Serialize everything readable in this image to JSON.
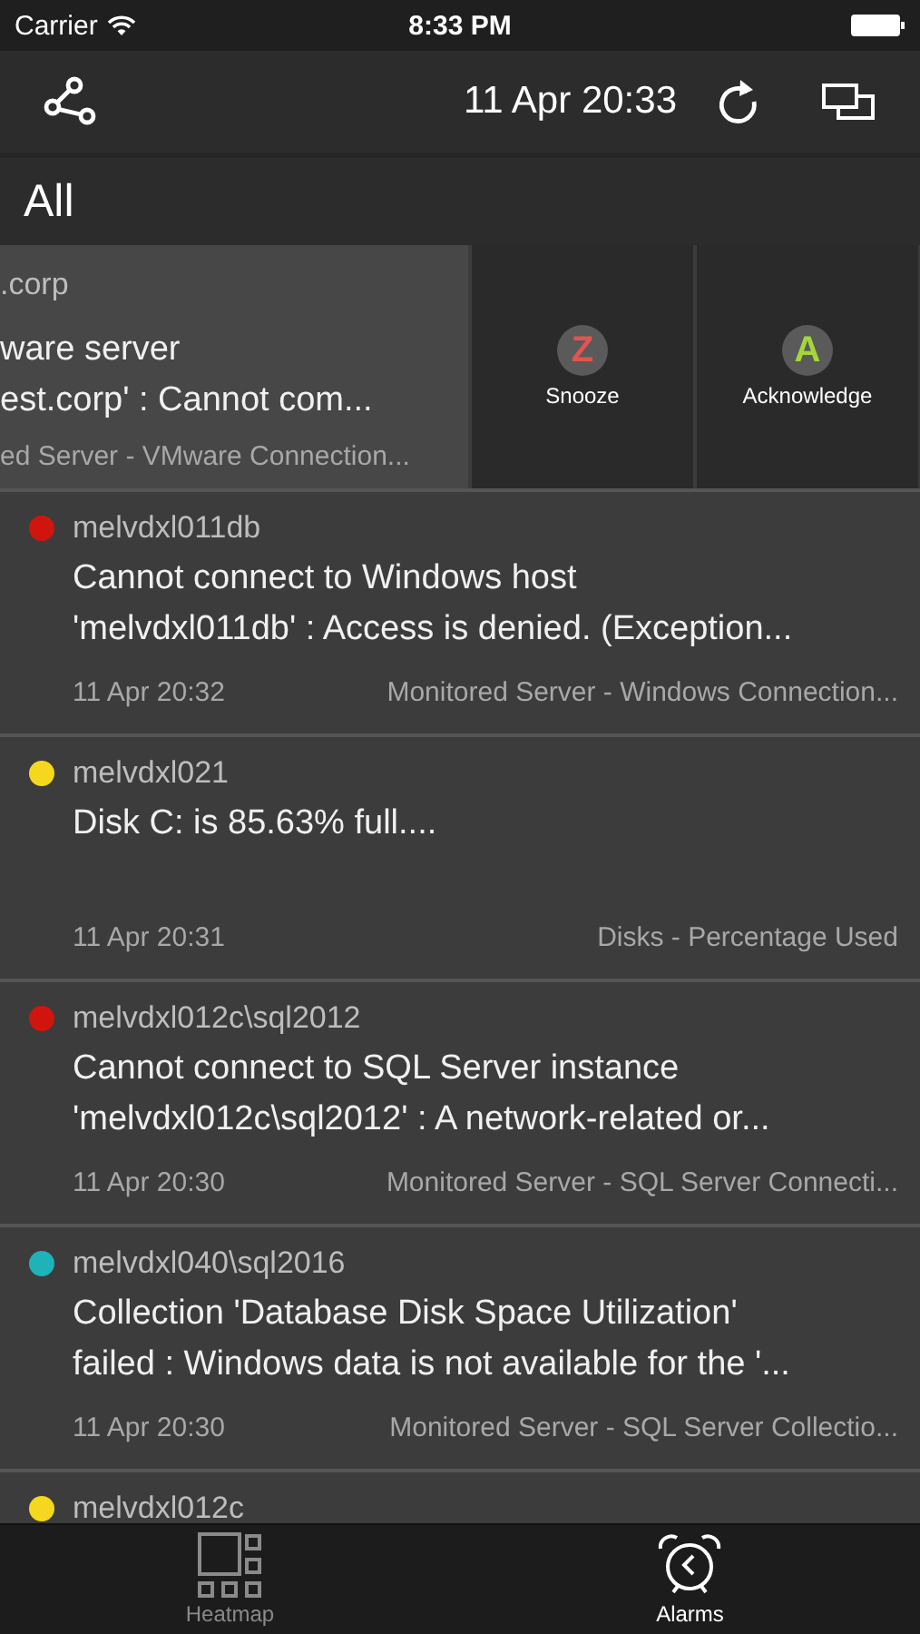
{
  "status_bar": {
    "carrier": "Carrier",
    "time": "8:33 PM"
  },
  "nav": {
    "timestamp": "11 Apr 20:33"
  },
  "section": {
    "title": "All"
  },
  "swiped_row": {
    "host": ".corp",
    "message_lines": [
      "ware server",
      "est.corp' : Cannot com..."
    ],
    "category": "ed Server - VMware Connection...",
    "actions": [
      {
        "letter": "Z",
        "label": "Snooze",
        "color": "#e0554f"
      },
      {
        "letter": "A",
        "label": "Acknowledge",
        "color": "#a5d63a"
      }
    ]
  },
  "alarms": [
    {
      "host": "melvdxl011db",
      "color": "#d0150f",
      "message_lines": [
        "Cannot connect to Windows host",
        "'melvdxl011db' : Access is denied. (Exception..."
      ],
      "time": "11 Apr 20:32",
      "category": "Monitored Server - Windows Connection..."
    },
    {
      "host": "melvdxl021",
      "color": "#f5d81d",
      "message_lines": [
        "Disk C: is 85.63% full...."
      ],
      "time": "11 Apr 20:31",
      "category": "Disks - Percentage Used"
    },
    {
      "host": "melvdxl012c\\sql2012",
      "color": "#d0150f",
      "message_lines": [
        "Cannot connect to SQL Server instance",
        "'melvdxl012c\\sql2012' : A network-related or..."
      ],
      "time": "11 Apr 20:30",
      "category": "Monitored Server - SQL Server Connecti..."
    },
    {
      "host": "melvdxl040\\sql2016",
      "color": "#1fb2b8",
      "message_lines": [
        "Collection 'Database Disk Space Utilization'",
        "failed : Windows data is not available for the '..."
      ],
      "time": "11 Apr 20:30",
      "category": "Monitored Server - SQL Server Collectio..."
    },
    {
      "host": "melvdxl012c",
      "color": "#f5d81d"
    }
  ],
  "tabs": [
    {
      "label": "Heatmap",
      "selected": false,
      "kind": "heatmap"
    },
    {
      "label": "Alarms",
      "selected": true,
      "kind": "alarms"
    }
  ]
}
